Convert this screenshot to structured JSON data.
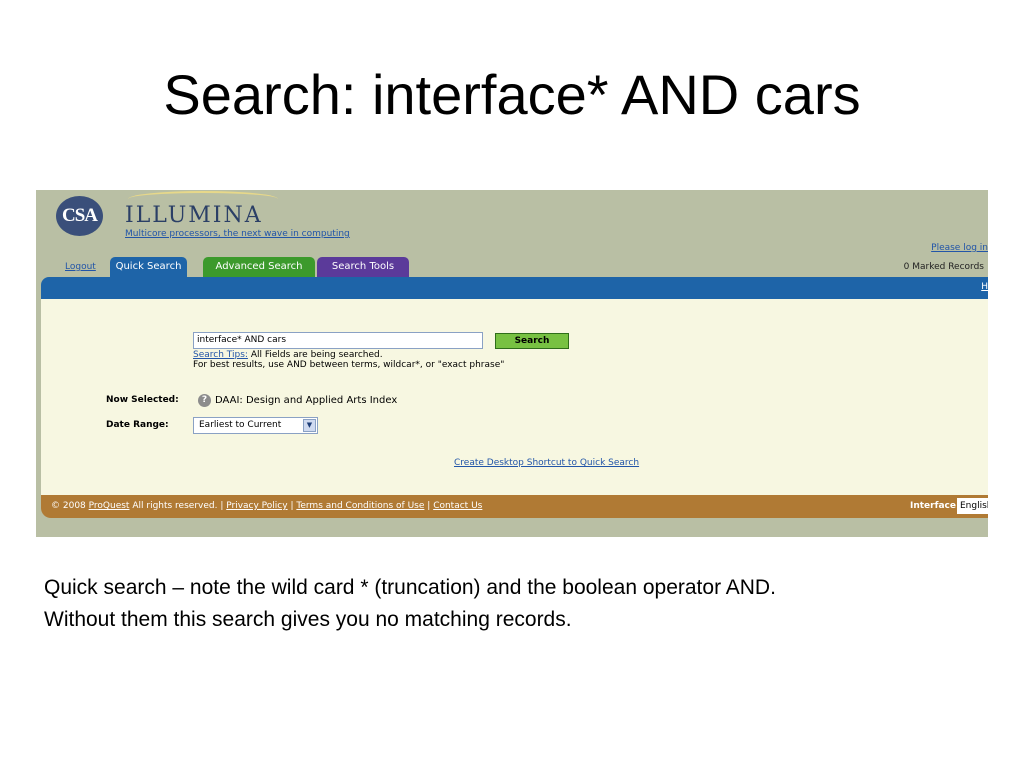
{
  "slide": {
    "title": "Search: interface* AND cars",
    "caption_line1": "Quick search – note the wild card * (truncation) and the boolean operator AND.",
    "caption_line2": "Without them this search gives you no matching records."
  },
  "header": {
    "logo_text": "CSA",
    "brand": "ILLUMINA",
    "tagline": "Multicore processors, the next wave in computing",
    "login_link": "Please log in",
    "logout": "Logout",
    "marked_records": "0 Marked Records"
  },
  "tabs": [
    {
      "label": "Quick Search",
      "color": "#1e64a8",
      "active": true
    },
    {
      "label": "Advanced Search",
      "color": "#3c9a2c",
      "active": false
    },
    {
      "label": "Search Tools",
      "color": "#5b3a9a",
      "active": false
    }
  ],
  "bar": {
    "right_link": "H"
  },
  "search": {
    "query_value": "interface* AND cars",
    "button_label": "Search",
    "tips_link": "Search Tips:",
    "tips_text": "All Fields are being searched.",
    "hint": "For best results, use AND between terms, wildcar*, or \"exact phrase\""
  },
  "selection": {
    "now_selected_label": "Now Selected:",
    "help_icon_glyph": "?",
    "database": "DAAI: Design and Applied Arts Index",
    "date_range_label": "Date Range:",
    "date_range_value": "Earliest to Current"
  },
  "shortcut_link": "Create Desktop Shortcut to Quick Search",
  "footer": {
    "copyright_prefix": "© 2008",
    "proquest": "ProQuest",
    "rights": "All rights reserved. |",
    "privacy": "Privacy Policy",
    "sep1": "|",
    "terms": "Terms and Conditions of Use",
    "sep2": "|",
    "contact": "Contact Us",
    "interface_label": "Interface",
    "language": "English"
  },
  "colors": {
    "header_bg": "#b9bfa4",
    "nav_blue": "#1e64a8",
    "panel_bg": "#f7f7e1",
    "footer_brown": "#b07a34",
    "search_button": "#78c142"
  }
}
